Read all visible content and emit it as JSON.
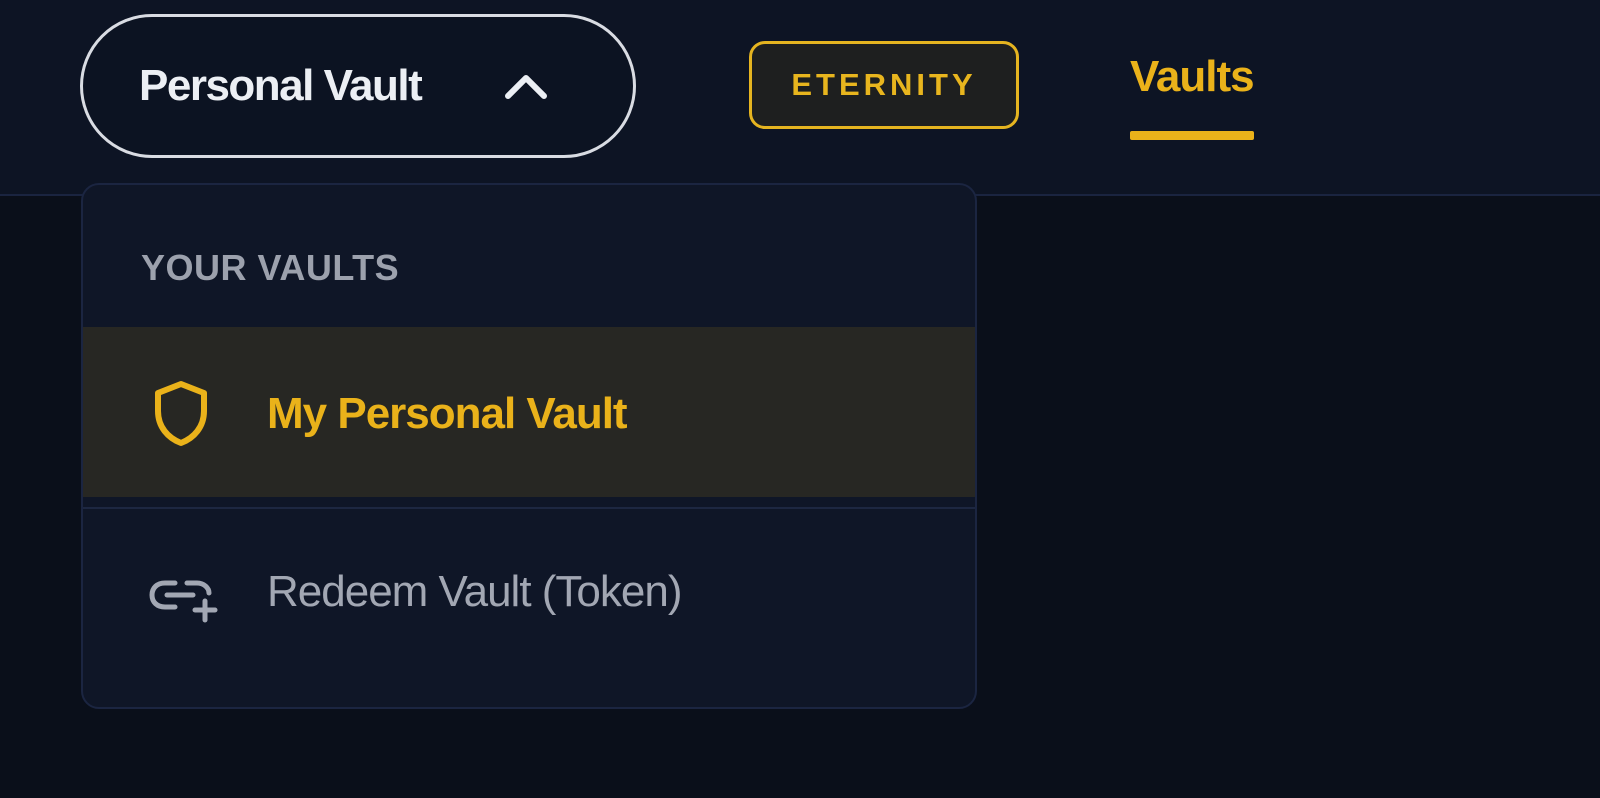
{
  "header": {
    "vault_switcher": {
      "label": "Personal Vault",
      "icon": "chevron-up-icon"
    },
    "plan_badge": {
      "label": "ETERNITY"
    },
    "nav": {
      "active_tab": "Vaults"
    }
  },
  "dropdown": {
    "section_title": "YOUR VAULTS",
    "items": [
      {
        "label": "My Personal Vault",
        "icon": "shield-icon",
        "selected": true
      },
      {
        "label": "Redeem Vault (Token)",
        "icon": "link-plus-icon",
        "selected": false
      }
    ]
  },
  "colors": {
    "accent": "#eab21a",
    "background": "#0a0f1a",
    "header": "#0d1424",
    "dropdown_bg": "#0f1627",
    "selected_item_bg": "#272723"
  }
}
